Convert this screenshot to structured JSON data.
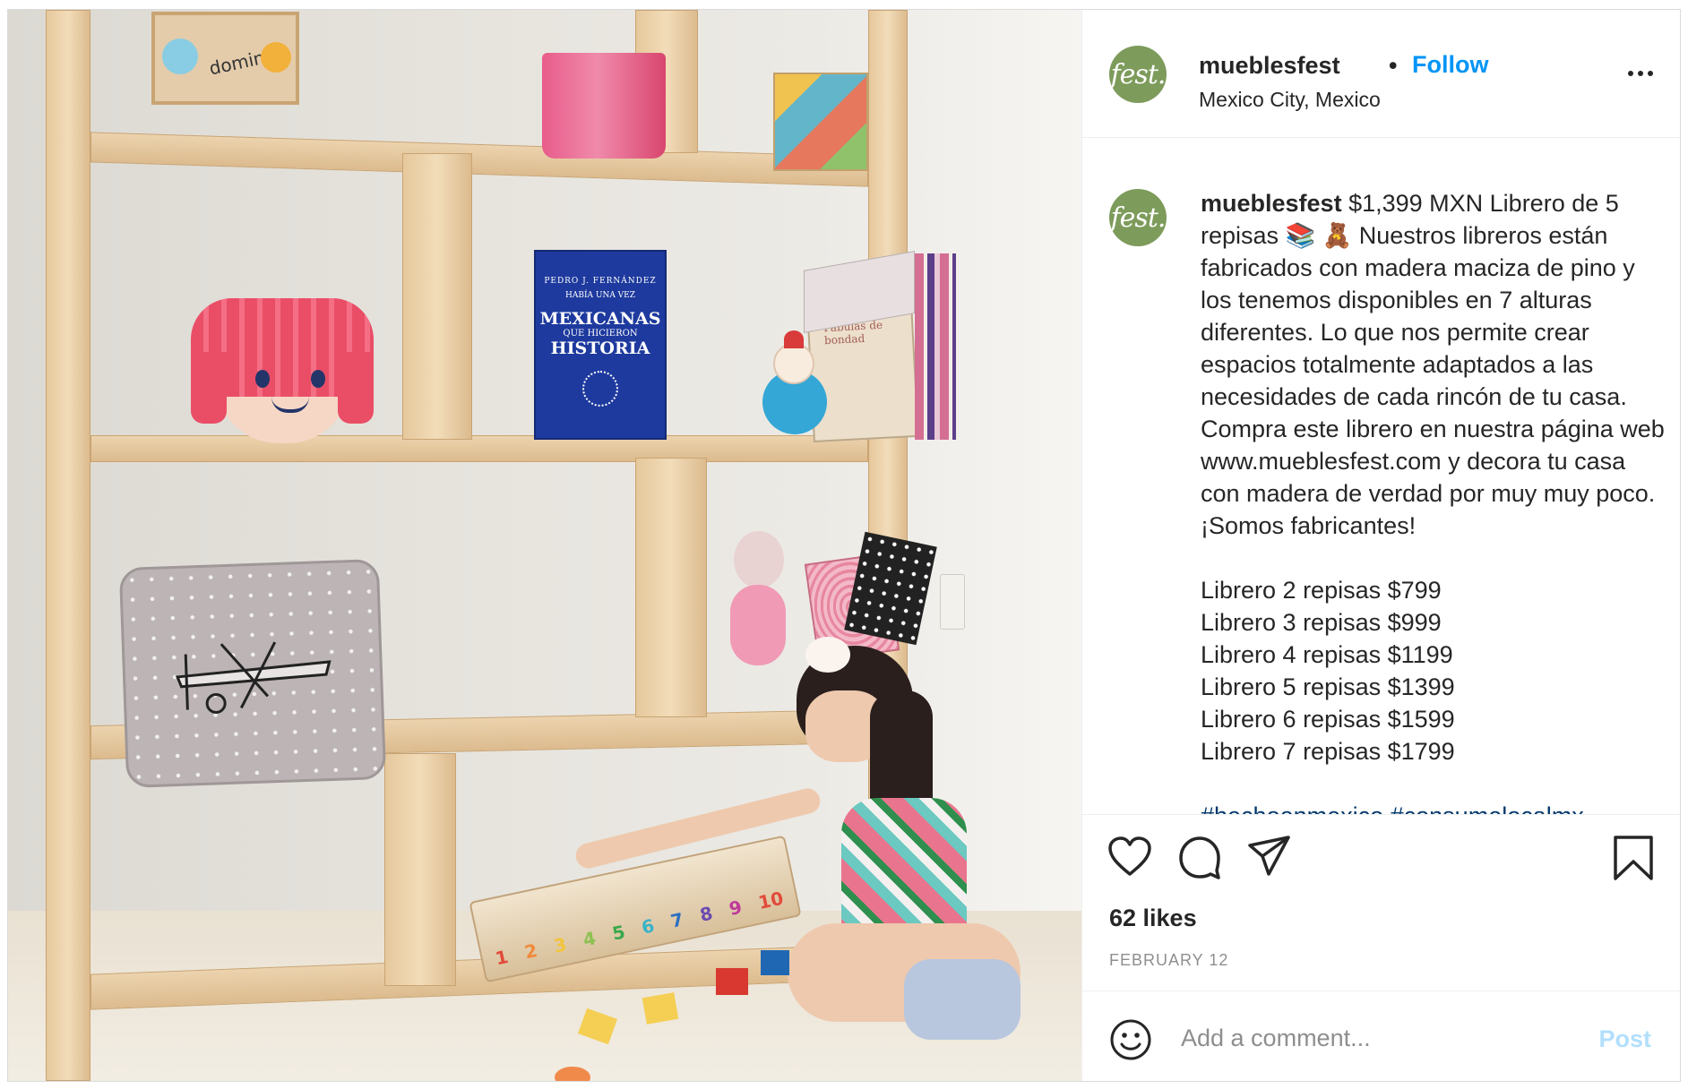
{
  "header": {
    "avatar_text": "fest.",
    "username": "mueblesfest",
    "separator": "•",
    "follow_label": "Follow",
    "location": "Mexico City, Mexico"
  },
  "caption": {
    "username": "mueblesfest",
    "text": "$1,399 MXN Librero de 5 repisas 📚 🧸 Nuestros libreros están fabricados con madera maciza de pino y los tenemos disponibles en 7 alturas diferentes. Lo que nos permite crear espacios totalmente adaptados a las necesidades de cada rincón de tu casa. Compra este librero en nuestra página web www.mueblesfest.com y decora tu casa con madera de verdad por muy muy poco. ¡Somos fabricantes!",
    "prices": [
      "Librero 2 repisas $799",
      "Librero 3 repisas $999",
      "Librero 4 repisas $1199",
      "Librero 5 repisas $1399",
      "Librero 6 repisas $1599",
      "Librero 7 repisas $1799"
    ],
    "hashtags": "#hechoenmexico #consumelocalmx"
  },
  "photo": {
    "domino_label": "domino",
    "book_title": "MEXICANAS",
    "book_subtitle": "QUE HICIERON",
    "book_title2": "HISTORIA",
    "book_author": "PEDRO J. FERNÁNDEZ",
    "book_kicker": "HABÍA UNA VEZ",
    "book2_title": "Fábulas de bondad",
    "counting_numbers": [
      "1",
      "2",
      "3",
      "4",
      "5",
      "6",
      "7",
      "8",
      "9",
      "10"
    ]
  },
  "actions": {
    "likes": "62 likes",
    "date": "FEBRUARY 12",
    "comment_placeholder": "Add a comment...",
    "post_label": "Post"
  },
  "icons": [
    "heart-icon",
    "comment-icon",
    "share-icon",
    "bookmark-icon",
    "more-icon",
    "emoji-icon"
  ],
  "colors": {
    "accent": "#0095f6",
    "avatar": "#7d9b5b",
    "post_disabled": "#b2dffc",
    "muted": "#8e8e8e"
  }
}
